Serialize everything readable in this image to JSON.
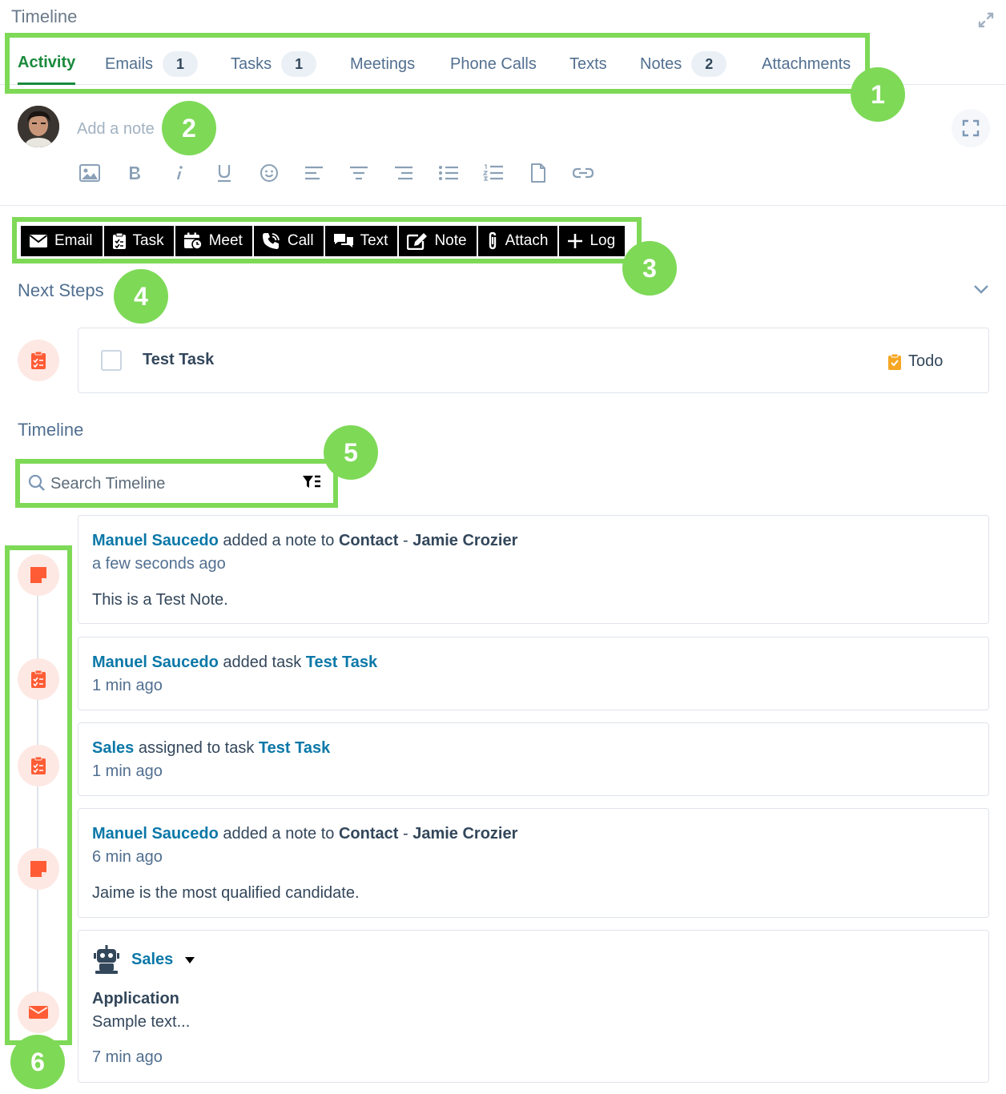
{
  "header": {
    "title": "Timeline"
  },
  "tabs": [
    {
      "label": "Activity",
      "count": null
    },
    {
      "label": "Emails",
      "count": "1"
    },
    {
      "label": "Tasks",
      "count": "1"
    },
    {
      "label": "Meetings",
      "count": null
    },
    {
      "label": "Phone Calls",
      "count": null
    },
    {
      "label": "Texts",
      "count": null
    },
    {
      "label": "Notes",
      "count": "2"
    },
    {
      "label": "Attachments",
      "count": null
    }
  ],
  "composer": {
    "placeholder": "Add a note"
  },
  "actions": [
    {
      "label": "Email",
      "icon": "email-icon"
    },
    {
      "label": "Task",
      "icon": "clipboard-icon"
    },
    {
      "label": "Meet",
      "icon": "calendar-icon"
    },
    {
      "label": "Call",
      "icon": "phone-icon"
    },
    {
      "label": "Text",
      "icon": "chat-icon"
    },
    {
      "label": "Note",
      "icon": "edit-icon"
    },
    {
      "label": "Attach",
      "icon": "paperclip-icon"
    },
    {
      "label": "Log",
      "icon": "plus-icon"
    }
  ],
  "next_steps": {
    "title": "Next Steps",
    "task": {
      "name": "Test Task",
      "status": "Todo"
    }
  },
  "timeline": {
    "title": "Timeline",
    "search_placeholder": "Search Timeline",
    "events": [
      {
        "actor": "Manuel Saucedo",
        "verb": "added a note to",
        "object": "Contact",
        "sep": "-",
        "target": "Jamie Crozier",
        "time": "a few seconds ago",
        "body": "This is a Test Note."
      },
      {
        "actor": "Manuel Saucedo",
        "verb": "added task",
        "target": "Test Task",
        "time": "1 min ago"
      },
      {
        "actor": "Sales",
        "verb": "assigned to task",
        "target": "Test Task",
        "time": "1 min ago"
      },
      {
        "actor": "Manuel Saucedo",
        "verb": "added a note to",
        "object": "Contact",
        "sep": "-",
        "target": "Jamie Crozier",
        "time": "6 min ago",
        "body": "Jaime is the most qualified candidate."
      },
      {
        "sender": "Sales",
        "subject": "Application",
        "preview": "Sample text...",
        "time": "7 min ago"
      }
    ]
  },
  "annotations": [
    "1",
    "2",
    "3",
    "4",
    "5",
    "6"
  ],
  "colors": {
    "accent_green": "#7ed957",
    "tab_active": "#1a8a3c",
    "link": "#0b78a8",
    "icon_orange": "#ff5c35",
    "todo_orange": "#f5a623"
  }
}
